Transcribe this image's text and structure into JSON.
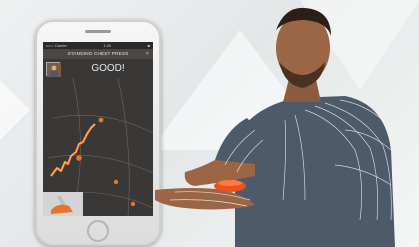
{
  "app": {
    "exercise_title": "STANDING CHEST PRESS",
    "feedback": "GOOD!",
    "close_glyph": "×"
  },
  "status_bar": {
    "carrier": "••○○ Carrier",
    "time": "1:20",
    "battery": "■"
  },
  "colors": {
    "trace": "#e8732a",
    "marker": "#e8732a",
    "screen_bg": "#3a3836",
    "shirt": "#4d5a69",
    "sensor": "#e8541e"
  },
  "icons": [
    "close-icon",
    "exercise-thumbnail-icon",
    "home-button-icon"
  ]
}
